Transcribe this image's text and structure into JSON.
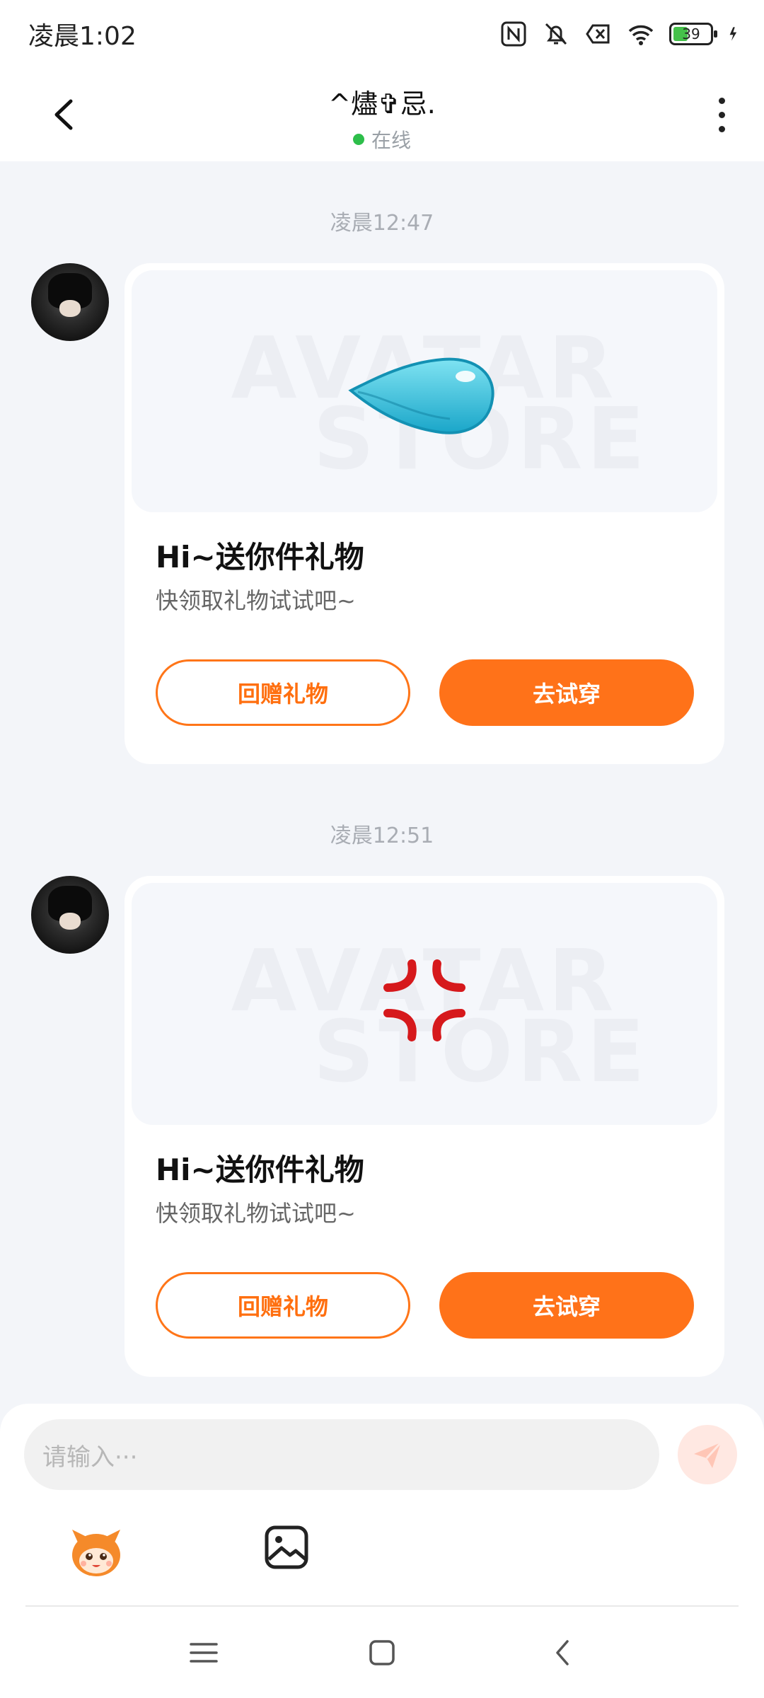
{
  "status_bar": {
    "time": "凌晨1:02",
    "battery_level": "39",
    "icons": [
      "nfc-icon",
      "bell-muted-icon",
      "sim-off-icon",
      "wifi-icon",
      "battery-icon",
      "charging-icon"
    ]
  },
  "header": {
    "title": "^燼✞忌.",
    "status": "在线",
    "status_color": "#2dbe4a"
  },
  "messages": [
    {
      "timestamp": "凌晨12:47",
      "watermark_line1": "AVATAR",
      "watermark_line2": "STORE",
      "gift_icon": "water-drop-emoji",
      "title": "Hi~送你件礼物",
      "subtitle": "快领取礼物试试吧~",
      "return_gift_label": "回赠礼物",
      "try_on_label": "去试穿"
    },
    {
      "timestamp": "凌晨12:51",
      "watermark_line1": "AVATAR",
      "watermark_line2": "STORE",
      "gift_icon": "anger-symbol-emoji",
      "title": "Hi~送你件礼物",
      "subtitle": "快领取礼物试试吧~",
      "return_gift_label": "回赠礼物",
      "try_on_label": "去试穿"
    }
  ],
  "composer": {
    "placeholder": "请输入···"
  },
  "colors": {
    "accent": "#ff7219",
    "background": "#f3f5f9"
  }
}
